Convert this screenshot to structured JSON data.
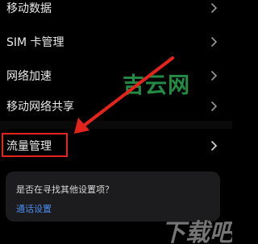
{
  "settings": {
    "items": [
      {
        "label": "移动数据"
      },
      {
        "label": "SIM 卡管理"
      },
      {
        "label": "网络加速"
      },
      {
        "label": "移动网络共享"
      },
      {
        "label": "流量管理"
      }
    ]
  },
  "suggestion": {
    "question": "是否在寻找其他设置项？",
    "link": "通话设置"
  },
  "watermarks": {
    "site": "吉云网",
    "download": "下载吧"
  },
  "colors": {
    "background": "#000000",
    "text": "#eaeaea",
    "chevron": "#9a9a9a",
    "highlight": "#e4241b",
    "link": "#4b8ef3",
    "card": "#1c1c1e",
    "watermark_green": "#27984a"
  }
}
